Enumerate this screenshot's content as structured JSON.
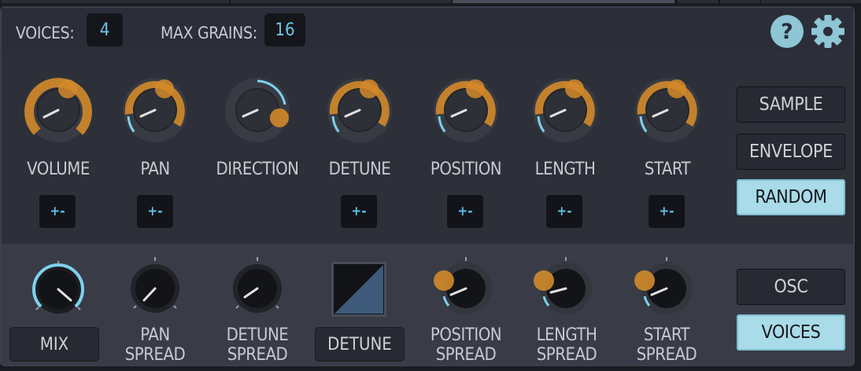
{
  "header": {
    "voices_label": "VOICES:",
    "voices_value": "4",
    "max_grains_label": "MAX GRAINS:",
    "max_grains_value": "16",
    "help_icon": "question-mark-icon",
    "settings_icon": "gear-icon"
  },
  "upper": {
    "knobs": [
      {
        "label": "VOLUME",
        "plusminus": "+-"
      },
      {
        "label": "PAN",
        "plusminus": "+-"
      },
      {
        "label": "DIRECTION"
      },
      {
        "label": "DETUNE",
        "plusminus": "+-"
      },
      {
        "label": "POSITION",
        "plusminus": "+-"
      },
      {
        "label": "LENGTH",
        "plusminus": "+-"
      },
      {
        "label": "START",
        "plusminus": "+-"
      }
    ]
  },
  "side_tabs_upper": [
    "SAMPLE",
    "ENVELOPE",
    "RANDOM"
  ],
  "side_tabs_upper_active": "RANDOM",
  "lower": {
    "mix_label": "MIX",
    "pan_spread": [
      "PAN",
      "SPREAD"
    ],
    "detune_spread": [
      "DETUNE",
      "SPREAD"
    ],
    "detune_button": "DETUNE",
    "position_spread": [
      "POSITION",
      "SPREAD"
    ],
    "length_spread": [
      "LENGTH",
      "SPREAD"
    ],
    "start_spread": [
      "START",
      "SPREAD"
    ]
  },
  "side_tabs_lower": [
    "OSC",
    "VOICES"
  ],
  "side_tabs_lower_active": "VOICES",
  "colors": {
    "accent_orange": "#d38a2a",
    "accent_blue": "#7fd1ee",
    "active_tab": "#a9dbe8"
  }
}
